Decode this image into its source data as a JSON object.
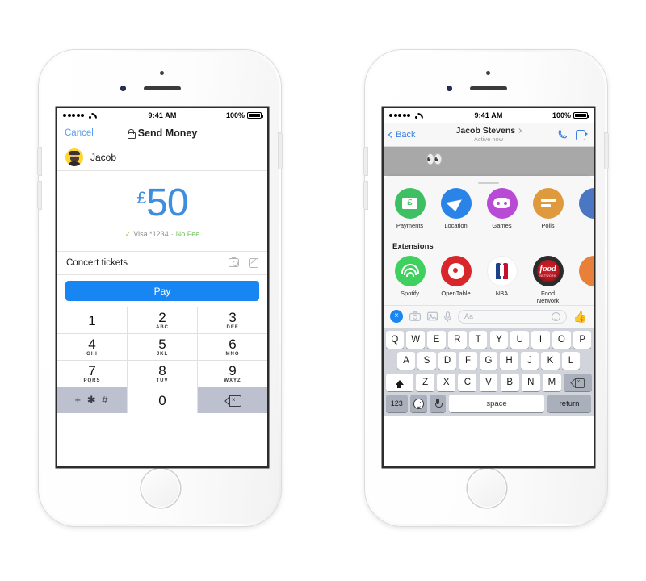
{
  "left_phone": {
    "status_bar": {
      "time": "9:41 AM",
      "battery": "100%",
      "signal_dots": 5
    },
    "nav": {
      "cancel": "Cancel",
      "title": "Send Money",
      "lock_icon": "lock-icon"
    },
    "recipient": {
      "name": "Jacob",
      "avatar": "user-avatar"
    },
    "amount": {
      "currency": "£",
      "value": "50",
      "color": "#3f8ddd",
      "check_glyph": "✓",
      "card": "Visa *1234",
      "separator": "·",
      "fee": "No Fee",
      "fee_color": "#6ec05d"
    },
    "memo": {
      "text": "Concert tickets",
      "camera_icon": "camera-icon",
      "note_icon": "note-icon"
    },
    "pay_button": {
      "label": "Pay",
      "color": "#1786f3"
    },
    "keypad": {
      "keys": [
        {
          "num": "1",
          "sub": ""
        },
        {
          "num": "2",
          "sub": "ABC"
        },
        {
          "num": "3",
          "sub": "DEF"
        },
        {
          "num": "4",
          "sub": "GHI"
        },
        {
          "num": "5",
          "sub": "JKL"
        },
        {
          "num": "6",
          "sub": "MNO"
        },
        {
          "num": "7",
          "sub": "PQRS"
        },
        {
          "num": "8",
          "sub": "TUV"
        },
        {
          "num": "9",
          "sub": "WXYZ"
        }
      ],
      "symbols": "+ ✱ #",
      "zero": "0",
      "delete_icon": "backspace-icon"
    }
  },
  "right_phone": {
    "status_bar": {
      "time": "9:41 AM",
      "battery": "100%",
      "signal_dots": 5
    },
    "nav": {
      "back": "Back",
      "name": "Jacob Stevens",
      "status": "Active now",
      "phone_icon": "phone-call-icon",
      "video_icon": "video-call-icon"
    },
    "apps": [
      {
        "label": "Payments",
        "icon": "payments-icon",
        "color": "#3fbf63"
      },
      {
        "label": "Location",
        "icon": "location-icon",
        "color": "#2a84e8"
      },
      {
        "label": "Games",
        "icon": "games-icon",
        "color": "#b84ad6"
      },
      {
        "label": "Polls",
        "icon": "polls-icon",
        "color": "#e09a3e"
      },
      {
        "label": "",
        "icon": "more-apps-icon",
        "color": "#4a76c4"
      }
    ],
    "extensions_title": "Extensions",
    "extensions": [
      {
        "label": "Spotify",
        "icon": "spotify-icon",
        "color": "#3fd05f"
      },
      {
        "label": "OpenTable",
        "icon": "opentable-icon",
        "color": "#d8262b"
      },
      {
        "label": "NBA",
        "icon": "nba-icon",
        "color": "#ffffff"
      },
      {
        "label": "Food Network",
        "icon": "food-network-icon",
        "color": "#b01820"
      },
      {
        "label": "",
        "icon": "more-extensions-icon",
        "color": "#e8803a"
      }
    ],
    "composer": {
      "close_icon": "close-x-icon",
      "camera_icon": "camera-icon",
      "photo_icon": "photo-icon",
      "mic_icon": "microphone-icon",
      "placeholder": "Aa",
      "emoji_icon": "emoji-icon",
      "like_icon": "thumbs-up-icon"
    },
    "keyboard": {
      "row1": [
        "Q",
        "W",
        "E",
        "R",
        "T",
        "Y",
        "U",
        "I",
        "O",
        "P"
      ],
      "row2": [
        "A",
        "S",
        "D",
        "F",
        "G",
        "H",
        "J",
        "K",
        "L"
      ],
      "row3": [
        "Z",
        "X",
        "C",
        "V",
        "B",
        "N",
        "M"
      ],
      "shift_icon": "shift-icon",
      "delete_icon": "backspace-icon",
      "numbers": "123",
      "emoji_icon": "emoji-icon",
      "dictation_icon": "microphone-icon",
      "space": "space",
      "return": "return"
    }
  }
}
